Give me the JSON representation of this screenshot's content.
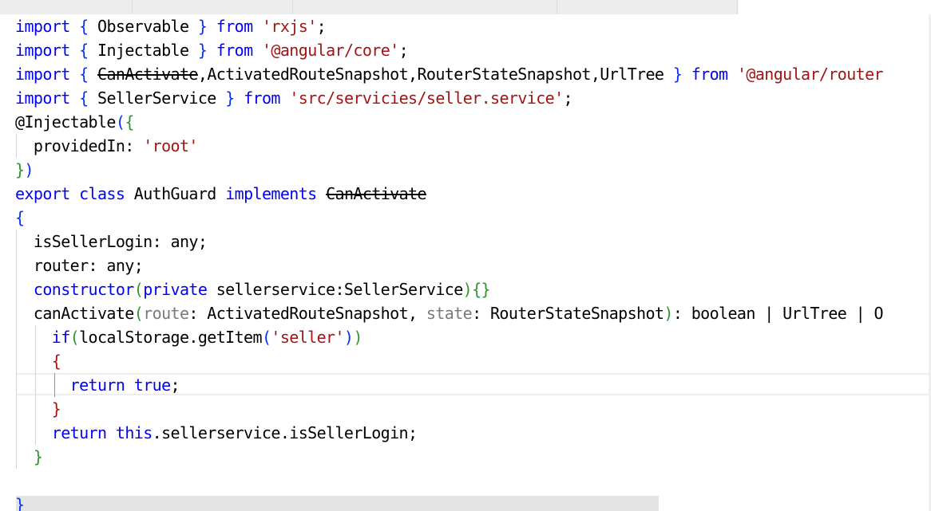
{
  "tabs": [
    {
      "label": ""
    },
    {
      "label": ""
    },
    {
      "label": ""
    },
    {
      "label": ""
    },
    {
      "label": ""
    }
  ],
  "code": {
    "l1": {
      "kw": "import",
      "open": "{",
      "name": " Observable ",
      "close": "}",
      "from": "from",
      "str": "'rxjs'",
      "end": ";"
    },
    "l2": {
      "kw": "import",
      "open": "{",
      "name": " Injectable ",
      "close": "}",
      "from": "from",
      "str": "'@angular/core'",
      "end": ";"
    },
    "l3": {
      "kw": "import",
      "open": "{",
      "deprecated": "CanActivate",
      "names": ",ActivatedRouteSnapshot,RouterStateSnapshot,UrlTree ",
      "close": "}",
      "from": "from",
      "str": "'@angular/router"
    },
    "l4": {
      "kw": "import",
      "open": "{",
      "name": " SellerService ",
      "close": "}",
      "from": "from",
      "str": "'src/servicies/seller.service'",
      "end": ";"
    },
    "l5": {
      "decorator": "@Injectable",
      "paren": "(",
      "brace": "{"
    },
    "l6": {
      "key": "providedIn: ",
      "str": "'root'"
    },
    "l7": {
      "brace": "}",
      "paren": ")"
    },
    "l8": {
      "export": "export",
      "class": "class",
      "name": " AuthGuard ",
      "implements": "implements",
      "deprecated": "CanActivate"
    },
    "l9": {
      "brace": "{"
    },
    "l10": {
      "text": "isSellerLogin: any;"
    },
    "l11": {
      "text": "router: any;"
    },
    "l12": {
      "ctor": "constructor",
      "open": "(",
      "private": "private",
      "param": " sellerservice:SellerService",
      "close": ")",
      "body": "{}"
    },
    "l13": {
      "fn": "canActivate",
      "open": "(",
      "route": "route",
      "t1": ": ActivatedRouteSnapshot, ",
      "state": "state",
      "t2": ": RouterStateSnapshot",
      "close": ")",
      "ret": ": boolean | UrlTree | O"
    },
    "l14": {
      "if": "if",
      "open": "(",
      "call": "localStorage.getItem",
      "open2": "(",
      "str": "'seller'",
      "close2": ")",
      "close": ")"
    },
    "l15": {
      "brace": "{"
    },
    "l16": {
      "ret": "return",
      "val": "true",
      "end": ";"
    },
    "l17": {
      "brace": "}"
    },
    "l18": {
      "ret": "return",
      "this": "this",
      "rest": ".sellerservice.isSellerLogin;"
    },
    "l19": {
      "brace": "}"
    },
    "l20": {
      "brace": "}"
    }
  },
  "colors": {
    "keyword": "#0000ff",
    "string": "#a31515",
    "bracket_level1": "#0431fa",
    "bracket_level2": "#319331",
    "parameter_hint": "#7a7a7a",
    "text": "#000000"
  }
}
